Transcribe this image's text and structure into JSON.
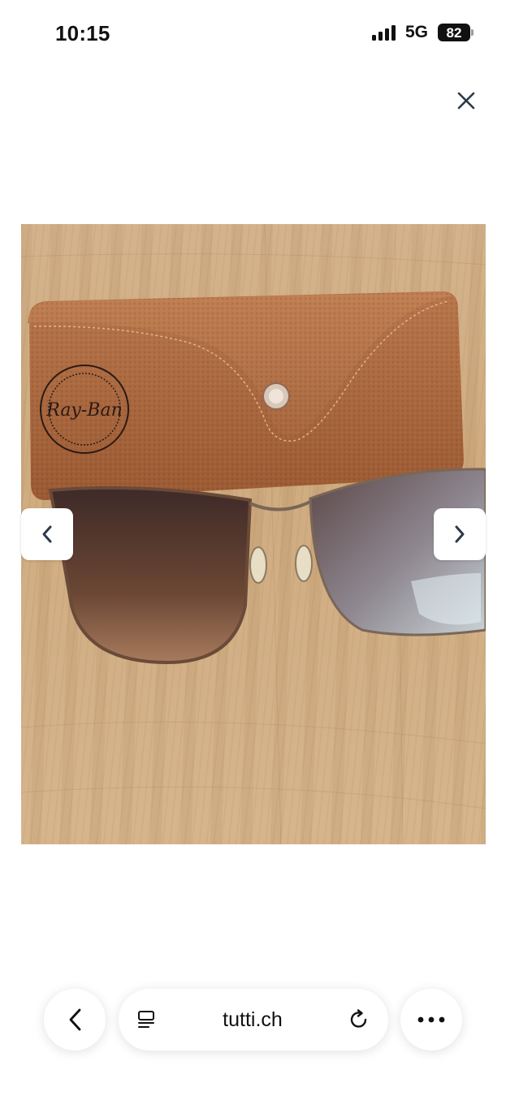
{
  "status_bar": {
    "time": "10:15",
    "network": "5G",
    "battery": "82"
  },
  "viewer": {
    "close_icon": "close-icon",
    "prev_icon": "chevron-left-icon",
    "next_icon": "chevron-right-icon",
    "photo_subject": "ray-ban sunglasses and leather case on wooden table",
    "case_logo_text": "Ray-Ban"
  },
  "browser": {
    "url": "tutti.ch",
    "back_icon": "chevron-left-icon",
    "reader_icon": "reader-icon",
    "reload_icon": "reload-icon",
    "more_icon": "ellipsis-icon"
  },
  "colors": {
    "accent_case": "#a8673f",
    "table": "#d2b087",
    "icon_dark": "#2c3a4a"
  }
}
